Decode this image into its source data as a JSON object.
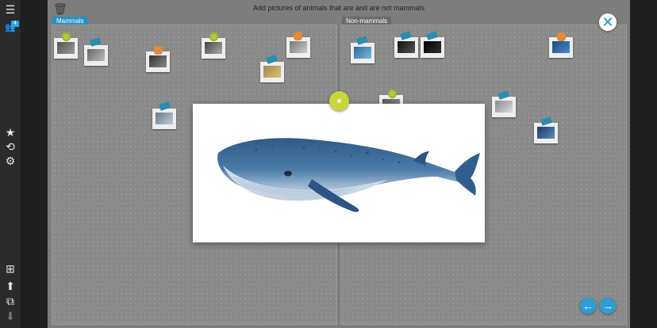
{
  "board": {
    "title": "Add pictures of animals that are and are not mammals"
  },
  "panels": {
    "left_label": "Mammals",
    "right_label": "Non-mammals"
  },
  "sidebar": {
    "user_badge": "4"
  },
  "colors": {
    "accent": "#2a9fd6",
    "board": "#7d7d7d",
    "sidebar": "#2b2b2b",
    "pin_green": "#c7d63a"
  },
  "icons": {
    "menu": "☰",
    "users": "👥",
    "star": "★",
    "reload": "⟲",
    "settings": "⚙",
    "add": "⊞",
    "upload": "⬆",
    "download": "⬇",
    "count": "⧉",
    "trash": "🗑",
    "close": "✕",
    "prev": "←",
    "next": "→"
  }
}
